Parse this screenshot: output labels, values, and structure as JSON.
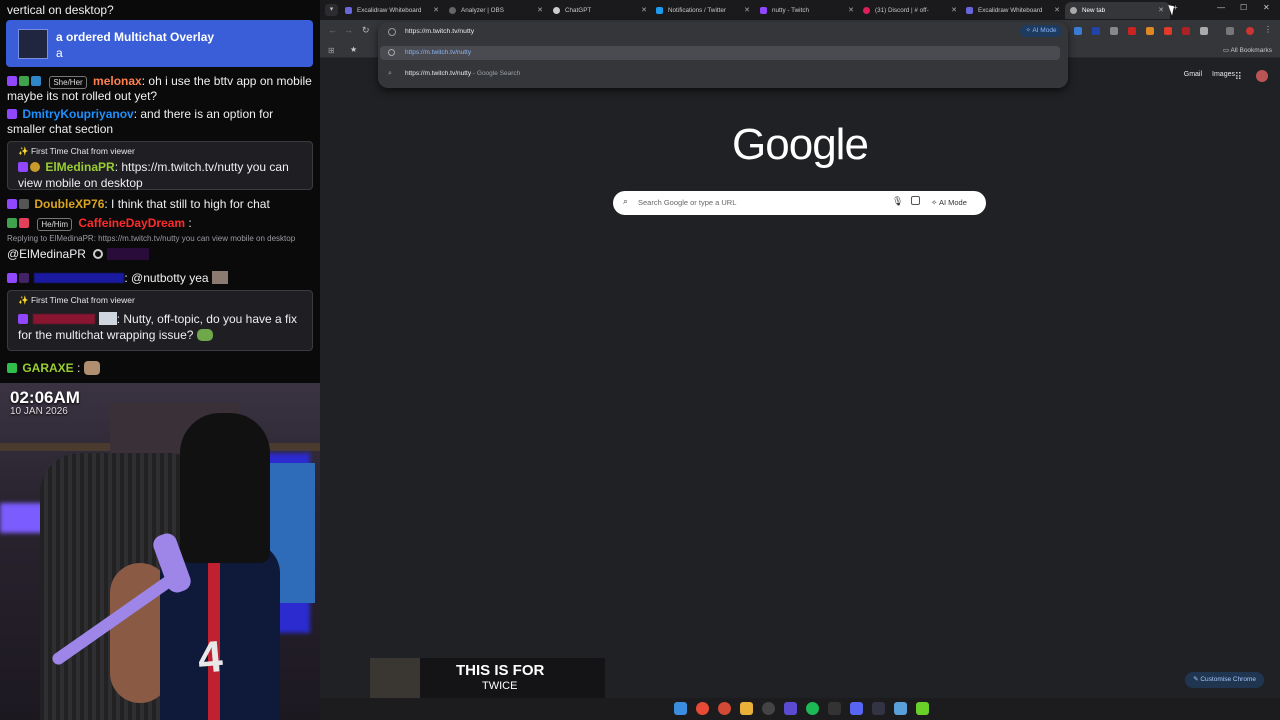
{
  "chat": {
    "prev_line": "vertical on desktop?",
    "multichat": {
      "title": "a ordered Multichat Overlay",
      "message": "a"
    },
    "messages": [
      {
        "pronoun": "She/Her",
        "user": "melonax",
        "text": ": oh i use the bttv app on mobile maybe its not rolled out yet?",
        "color": "#ff7f50"
      },
      {
        "user": "DmitryKoupriyanov",
        "text": ": and there is an option for smaller chat section",
        "color": "#1e90ff"
      },
      {
        "user": "DoubleXP76",
        "text": ": I think that still to high for chat",
        "color": "#daa520"
      },
      {
        "pronoun": "He/Him",
        "user": "CaffeineDayDream",
        "text": " :",
        "color": "#ff2a2a"
      },
      {
        "user": "",
        "text": ": @nutbotty yea",
        "color": "#1a1aa0"
      },
      {
        "user": "GARAXE",
        "text": " :",
        "color": "#9acd32"
      }
    ],
    "first_time": [
      {
        "header": "First Time Chat from viewer",
        "user": "ElMedinaPR",
        "text": ": https://m.twitch.tv/nutty you can view mobile on desktop",
        "color": "#9acd32"
      },
      {
        "header": "First Time Chat from viewer",
        "user": "",
        "text": ": Nutty, off-topic, do you have a fix for the multichat wrapping issue?",
        "color": "#cc2244"
      }
    ],
    "reply_note": "Replying to ElMedinaPR: https://m.twitch.tv/nutty you can view mobile on desktop",
    "mention": "@ElMedinaPR"
  },
  "cam": {
    "time": "02:06AM",
    "date": "10 JAN 2026",
    "jersey": "4"
  },
  "browser": {
    "tabs": [
      {
        "label": "Excalidraw Whiteboard",
        "icon": "excalidraw-icon",
        "color": "#6965db"
      },
      {
        "label": "Analyzer | OBS",
        "icon": "obs-icon",
        "color": "#666666"
      },
      {
        "label": "ChatGPT",
        "icon": "chatgpt-icon",
        "color": "#cccccc"
      },
      {
        "label": "Notifications / Twitter",
        "icon": "twitter-icon",
        "color": "#1d9bf0"
      },
      {
        "label": "nutty - Twitch",
        "icon": "twitch-icon",
        "color": "#9146ff"
      },
      {
        "label": "(31) Discord | # off-",
        "icon": "discord-icon",
        "color": "#e01e5a"
      },
      {
        "label": "Excalidraw Whiteboard",
        "icon": "excalidraw-icon",
        "color": "#6965db"
      },
      {
        "label": "New tab",
        "icon": "chrome-icon",
        "color": "#aaaaaa",
        "active": true
      }
    ],
    "url": "https://m.twitch.tv/nutty",
    "suggestion_1": "https://m.twitch.tv/nutty",
    "suggestion_2": "https://m.twitch.tv/nutty",
    "suggestion_2_suffix": " - Google Search",
    "ai_mode": "AI Mode",
    "all_bookmarks": "All Bookmarks",
    "gmail": "Gmail",
    "images": "Images",
    "logo": "Google",
    "search_placeholder": "Search Google or type a URL",
    "search_ai_mode": "AI Mode",
    "customise": "Customise Chrome"
  },
  "caption": {
    "line1": "THIS IS FOR",
    "line2": "TWICE"
  }
}
